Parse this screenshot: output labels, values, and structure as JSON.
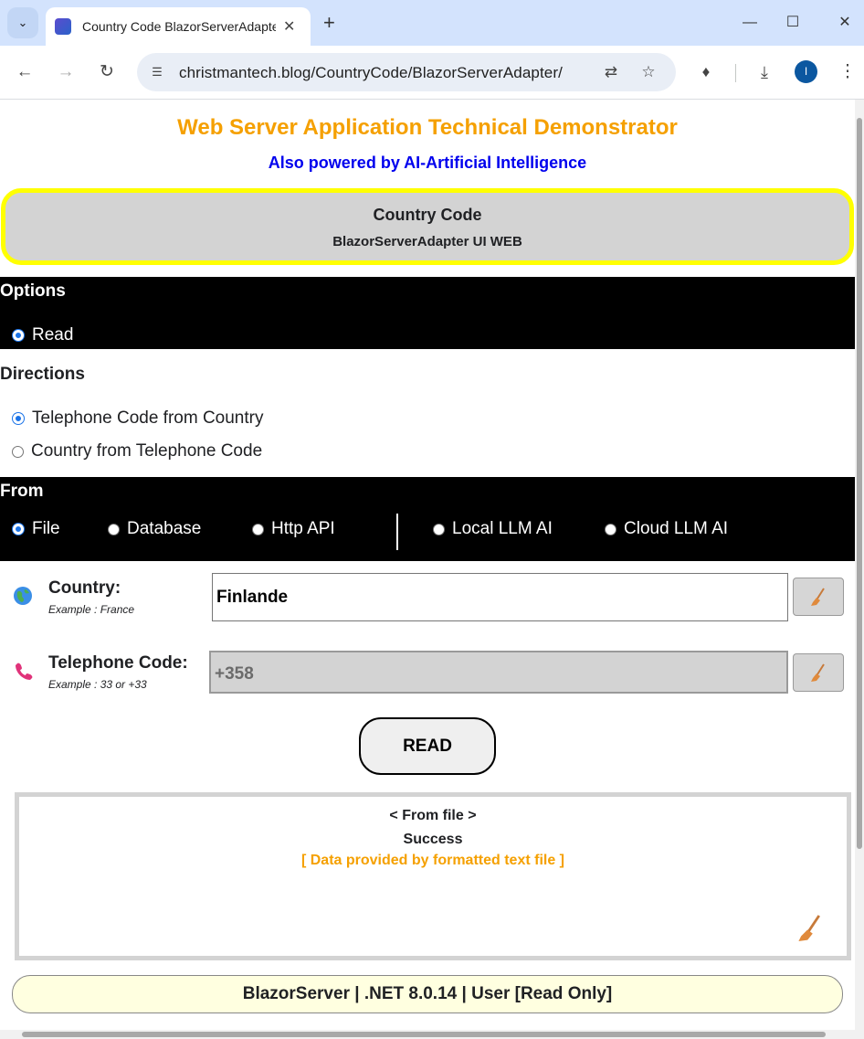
{
  "browser": {
    "tab_title": "Country Code BlazorServerAdapter",
    "url": "christmantech.blog/CountryCode/BlazorServerAdapter/",
    "profile_initial": "I",
    "icons": [
      "tab-search-icon",
      "close-icon",
      "new-tab-icon",
      "minimize-icon",
      "maximize-icon",
      "window-close-icon",
      "back-icon",
      "forward-icon",
      "reload-icon",
      "site-info-icon",
      "translate-icon",
      "bookmark-star-icon",
      "extensions-icon",
      "download-icon",
      "more-menu-icon"
    ]
  },
  "header": {
    "title": "Web Server Application Technical Demonstrator",
    "subtitle": "Also powered by AI-Artificial Intelligence",
    "title_color": "#f5a000",
    "subtitle_color": "#0000ee"
  },
  "banner": {
    "title": "Country Code",
    "subtitle": "BlazorServerAdapter UI WEB",
    "border_color": "#ffff00"
  },
  "options": {
    "title": "Options",
    "items": [
      {
        "label": "Read",
        "checked": true
      }
    ]
  },
  "directions": {
    "title": "Directions",
    "items": [
      {
        "label": "Telephone Code from Country",
        "checked": true
      },
      {
        "label": "Country from Telephone Code",
        "checked": false
      }
    ]
  },
  "from": {
    "title": "From",
    "items": [
      {
        "label": "File",
        "checked": true
      },
      {
        "label": "Database",
        "checked": false
      },
      {
        "label": "Http API",
        "checked": false
      },
      {
        "label": "Local LLM AI",
        "checked": false
      },
      {
        "label": "Cloud LLM AI",
        "checked": false
      }
    ]
  },
  "country": {
    "label": "Country:",
    "example": "Example : France",
    "value": "Finlande",
    "icon": "globe-icon"
  },
  "telephone": {
    "label": "Telephone Code:",
    "example": "Example : 33 or +33",
    "value": "+358",
    "icon": "telephone-icon"
  },
  "read_button": "READ",
  "result": {
    "source": "< From file >",
    "status": "Success",
    "note": "[ Data provided by formatted text file ]",
    "note_color": "#f5a000"
  },
  "footer": "BlazorServer | .NET 8.0.14 | User [Read Only]"
}
